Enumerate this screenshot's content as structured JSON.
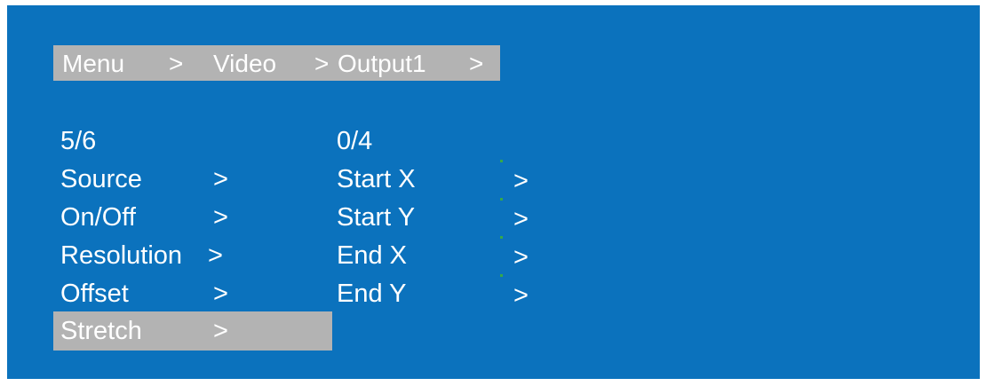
{
  "breadcrumb": {
    "menu": "Menu",
    "sep1": ">",
    "video": "Video",
    "sep2": ">",
    "output": "Output1",
    "sep3": ">"
  },
  "left_menu": {
    "counter": "5/6",
    "items": [
      {
        "label": "Source",
        "arrow": ">"
      },
      {
        "label": "On/Off",
        "arrow": ">"
      },
      {
        "label": "Resolution",
        "arrow": ">"
      },
      {
        "label": "Offset",
        "arrow": ">"
      },
      {
        "label": "Stretch",
        "arrow": ">"
      }
    ],
    "selected_index": 4
  },
  "right_menu": {
    "counter": "0/4",
    "items": [
      {
        "label": "Start  X",
        "arrow": ">"
      },
      {
        "label": "Start  Y",
        "arrow": ">"
      },
      {
        "label": "End  X",
        "arrow": ">"
      },
      {
        "label": "End  Y",
        "arrow": ">"
      }
    ]
  },
  "colors": {
    "background": "#0b72bd",
    "highlight": "#b3b3b3",
    "text": "#ffffff"
  }
}
